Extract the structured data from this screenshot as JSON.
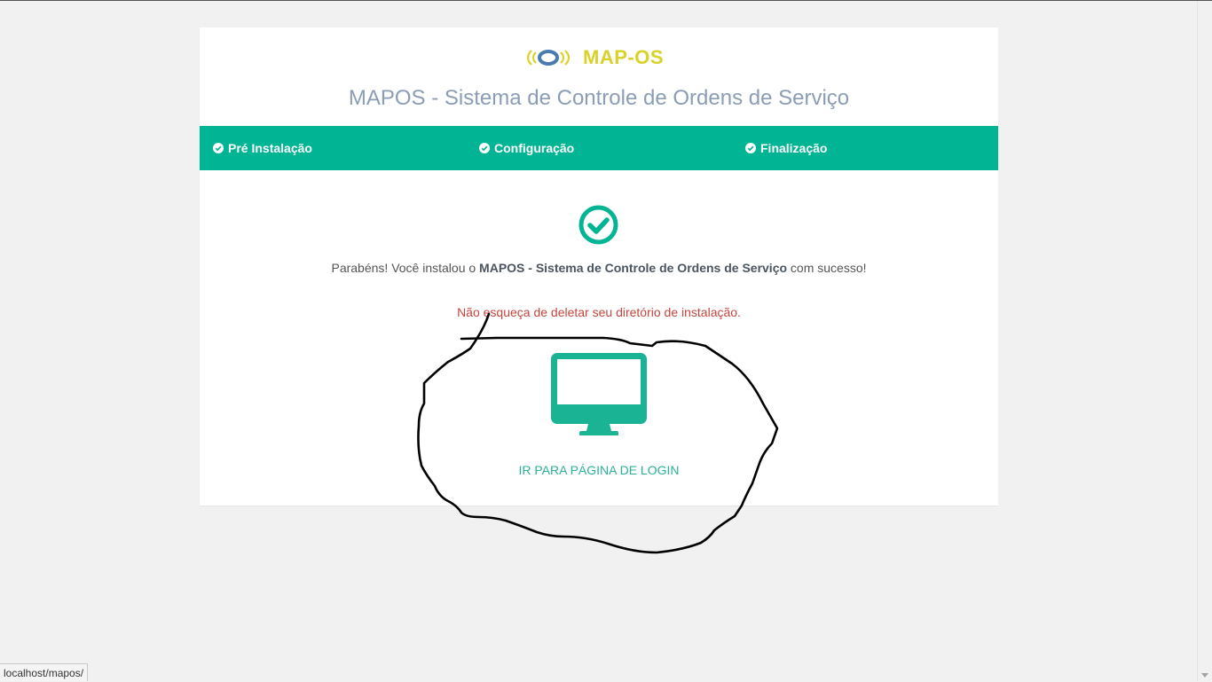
{
  "logo": {
    "text": "MAP-OS",
    "icon": "signal-ring-icon",
    "colors": {
      "ring_blue": "#4a7bb0",
      "wave_yellow": "#e0d02a",
      "text_yellow": "#d8d22a"
    }
  },
  "header": {
    "title": "MAPOS - Sistema de Controle de Ordens de Serviço"
  },
  "steps": [
    {
      "label": "Pré Instalação",
      "icon": "check-circle-icon",
      "completed": true
    },
    {
      "label": "Configuração",
      "icon": "check-circle-icon",
      "completed": true
    },
    {
      "label": "Finalização",
      "icon": "check-circle-icon",
      "completed": true
    }
  ],
  "result": {
    "icon": "check-circle-icon",
    "message_prefix": "Parabéns! Você instalou o ",
    "message_bold": "MAPOS - Sistema de Controle de Ordens de Serviço",
    "message_suffix": " com sucesso!",
    "warning": "Não esqueça de deletar seu diretório de instalação."
  },
  "login": {
    "icon": "desktop-monitor-icon",
    "label": "IR PARA PÁGINA DE LOGIN"
  },
  "browser": {
    "status_url": "localhost/mapos/"
  },
  "colors": {
    "accent": "#00b494",
    "title": "#8b9db6",
    "warning": "#c5453e",
    "link": "#2bb099",
    "background": "#f1f1f1"
  }
}
